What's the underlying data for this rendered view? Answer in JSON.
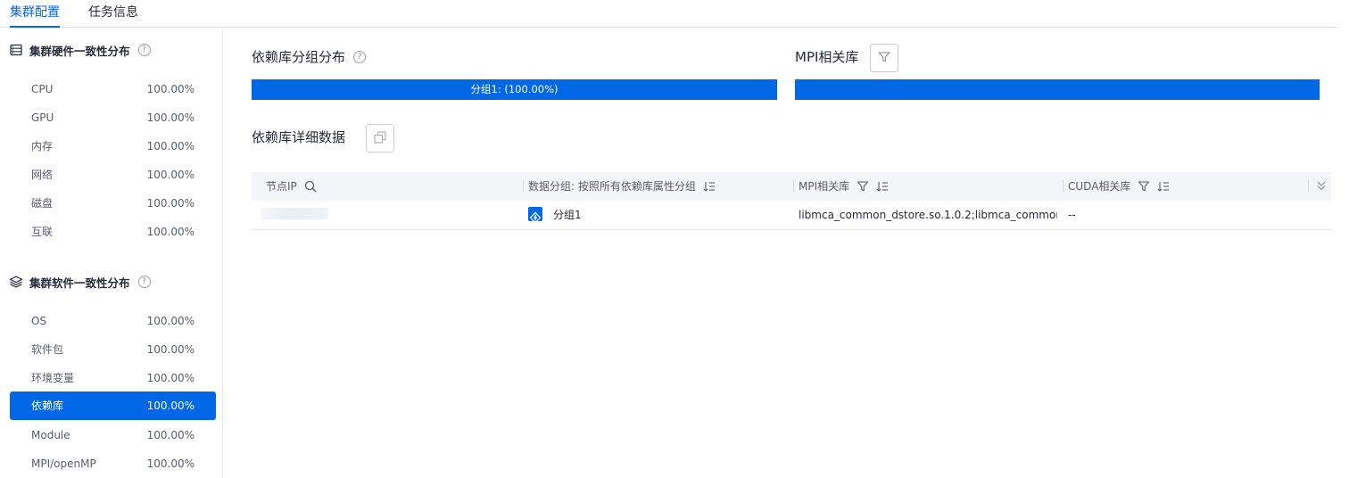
{
  "tabs": [
    {
      "label": "集群配置",
      "active": true
    },
    {
      "label": "任务信息",
      "active": false
    }
  ],
  "sidebar": {
    "hardware": {
      "title": "集群硬件一致性分布",
      "items": [
        {
          "name": "CPU",
          "percent": "100.00%"
        },
        {
          "name": "GPU",
          "percent": "100.00%"
        },
        {
          "name": "内存",
          "percent": "100.00%"
        },
        {
          "name": "网络",
          "percent": "100.00%"
        },
        {
          "name": "磁盘",
          "percent": "100.00%"
        },
        {
          "name": "互联",
          "percent": "100.00%"
        }
      ]
    },
    "software": {
      "title": "集群软件一致性分布",
      "items": [
        {
          "name": "OS",
          "percent": "100.00%"
        },
        {
          "name": "软件包",
          "percent": "100.00%"
        },
        {
          "name": "环境变量",
          "percent": "100.00%"
        },
        {
          "name": "依赖库",
          "percent": "100.00%",
          "active": true
        },
        {
          "name": "Module",
          "percent": "100.00%"
        },
        {
          "name": "MPI/openMP",
          "percent": "100.00%"
        }
      ]
    }
  },
  "main": {
    "group_dist_title": "依赖库分组分布",
    "group_bar": {
      "label": "分组1: (100.00%)",
      "fraction": 1.0
    },
    "mpi_title": "MPI相关库",
    "mpi_bar": {
      "fraction": 1.0
    },
    "detail_title": "依赖库详细数据",
    "table": {
      "columns": [
        "节点IP",
        "数据分组: 按照所有依赖库属性分组",
        "MPI相关库",
        "CUDA相关库"
      ],
      "rows": [
        {
          "ip": "",
          "group": "分组1",
          "mpi": "libmca_common_dstore.so.1.0.2;libmca_common_m...",
          "cuda": "--"
        }
      ]
    }
  },
  "colors": {
    "accent": "#0067e6",
    "text": "#252b3a",
    "muted": "#575d6c",
    "header_bg": "#f3f5f8"
  },
  "icons": [
    "help-icon",
    "server-icon",
    "layers-icon",
    "filter-icon",
    "copy-icon",
    "search-icon",
    "sort-icon",
    "double-chevron-down-icon",
    "group-node-icon"
  ]
}
